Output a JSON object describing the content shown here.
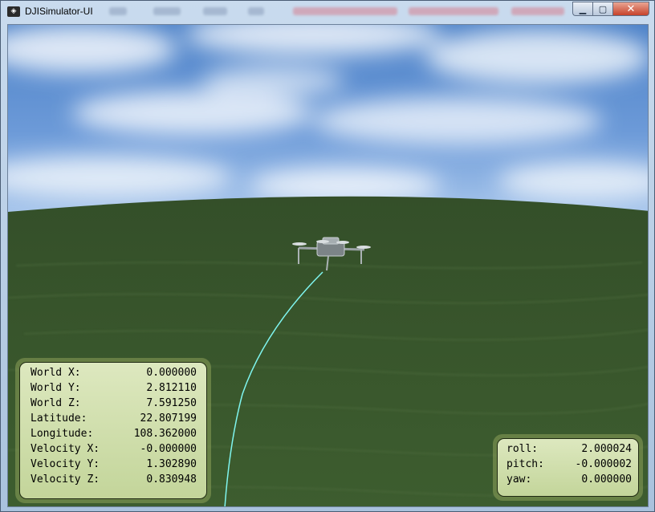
{
  "window": {
    "title": "DJISimulator-UI",
    "controls": {
      "minimize": "▁",
      "maximize": "▢",
      "close": "✕"
    }
  },
  "telemetry": {
    "world_x": {
      "label": "World X:",
      "value": "0.000000"
    },
    "world_y": {
      "label": "World Y:",
      "value": "2.812110"
    },
    "world_z": {
      "label": "World Z:",
      "value": "7.591250"
    },
    "latitude": {
      "label": "Latitude:",
      "value": "22.807199"
    },
    "longitude": {
      "label": "Longitude:",
      "value": "108.362000"
    },
    "velocity_x": {
      "label": "Velocity X:",
      "value": "-0.000000"
    },
    "velocity_y": {
      "label": "Velocity Y:",
      "value": "1.302890"
    },
    "velocity_z": {
      "label": "Velocity Z:",
      "value": "0.830948"
    }
  },
  "attitude": {
    "roll": {
      "label": "roll:",
      "value": "2.000024"
    },
    "pitch": {
      "label": "pitch:",
      "value": "-0.000002"
    },
    "yaw": {
      "label": "yaw:",
      "value": "0.000000"
    }
  },
  "colors": {
    "ground": "#3a5a2c",
    "sky": "#5b8fd0",
    "trajectory": "#7ff5ef",
    "panel": "#d3e0ad"
  },
  "icons": [
    "dji-logo-icon",
    "minimize-icon",
    "maximize-icon",
    "close-icon"
  ]
}
